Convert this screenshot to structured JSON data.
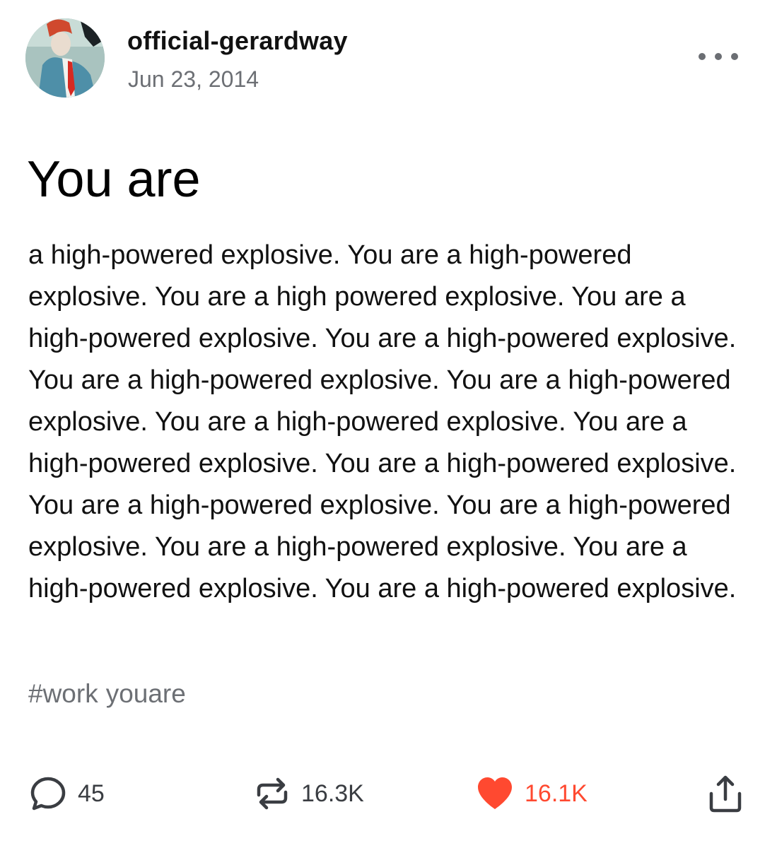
{
  "post": {
    "author": {
      "username": "official-gerardway",
      "avatar_icon": "avatar-photo"
    },
    "date": "Jun 23, 2014",
    "more_icon": "more-options-icon",
    "title": "You are",
    "body": "a high-powered explosive. You are a high-powered explosive. You are a high powered explosive. You are a high-powered explosive. You are a high-powered explosive. You are a high-powered explosive. You are a high-powered explosive. You are a high-powered explosive. You are a high-powered explosive. You are a high-powered explosive. You are a high-powered explosive. You are a high-powered explosive. You are a high-powered explosive. You are a high-powered explosive. You are a high-powered explosive.",
    "tags": [
      "#work",
      "youare"
    ]
  },
  "actions": {
    "replies": {
      "icon": "comment-icon",
      "count": "45"
    },
    "reblogs": {
      "icon": "reblog-icon",
      "count": "16.3K"
    },
    "likes": {
      "icon": "heart-icon",
      "count": "16.1K"
    },
    "share": {
      "icon": "share-icon"
    }
  },
  "colors": {
    "like_accent": "#ff4930",
    "secondary_text": "#6c6f74",
    "icon_gray": "#3a3d42"
  }
}
